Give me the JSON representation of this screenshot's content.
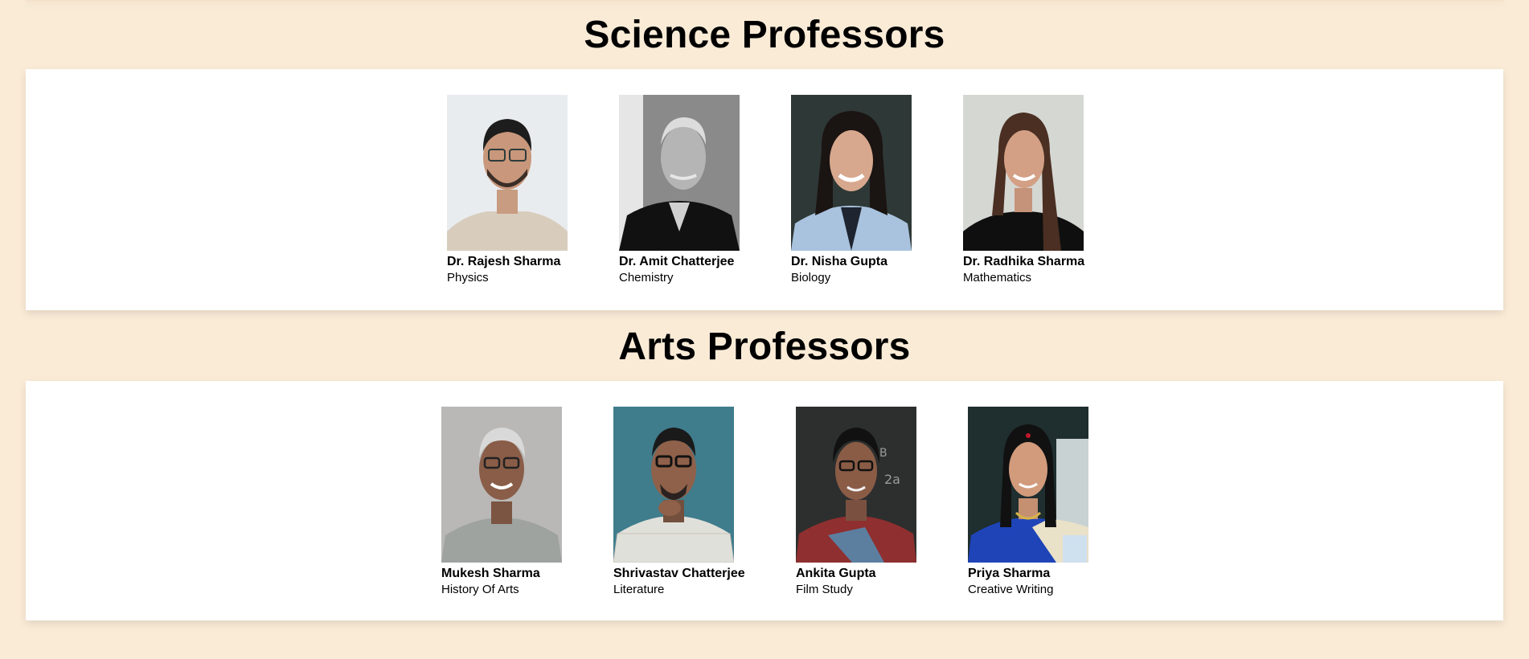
{
  "sections": [
    {
      "title": "Science Professors",
      "professors": [
        {
          "name": "Dr. Rajesh Sharma",
          "subject": "Physics"
        },
        {
          "name": "Dr. Amit Chatterjee",
          "subject": "Chemistry"
        },
        {
          "name": "Dr. Nisha Gupta",
          "subject": "Biology"
        },
        {
          "name": "Dr. Radhika Sharma",
          "subject": "Mathematics"
        }
      ]
    },
    {
      "title": "Arts Professors",
      "professors": [
        {
          "name": "Mukesh Sharma",
          "subject": "History Of Arts"
        },
        {
          "name": "Shrivastav Chatterjee",
          "subject": "Literature"
        },
        {
          "name": "Ankita Gupta",
          "subject": "Film Study"
        },
        {
          "name": "Priya Sharma",
          "subject": "Creative Writing"
        }
      ]
    }
  ],
  "colors": {
    "page_background": "#faebd7",
    "panel_background": "#ffffff"
  }
}
